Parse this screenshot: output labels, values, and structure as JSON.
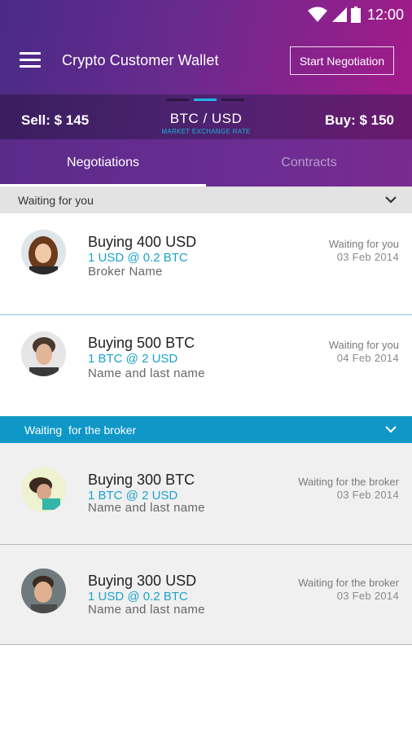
{
  "status_bar": {
    "time": "12:00"
  },
  "header": {
    "title": "Crypto Customer Wallet",
    "start_button": "Start Negotiation"
  },
  "rate_bar": {
    "sell": "Sell: $ 145",
    "pair": "BTC / USD",
    "subtitle": "MARKET EXCHANGE RATE",
    "buy": "Buy: $ 150",
    "accent": "#21b6e0"
  },
  "tabs": [
    {
      "label": "Negotiations",
      "active": true
    },
    {
      "label": "Contracts",
      "active": false
    }
  ],
  "sections": [
    {
      "title": "Waiting for you",
      "items": [
        {
          "title": "Buying 400 USD",
          "rate": "1 USD @ 0.2 BTC",
          "name": "Broker Name",
          "status": "Waiting for you",
          "date": "03 Feb 2014"
        },
        {
          "title": "Buying 500 BTC",
          "rate": "1 BTC @ 2 USD",
          "name": "Name and last name",
          "status": "Waiting for you",
          "date": "04 Feb 2014"
        }
      ]
    },
    {
      "title": "Waiting  for the broker",
      "items": [
        {
          "title": "Buying 300 BTC",
          "rate": "1 BTC @ 2 USD",
          "name": "Name and last name",
          "status": "Waiting for the broker",
          "date": "03 Feb 2014"
        },
        {
          "title": "Buying 300 USD",
          "rate": "1 USD @ 0.2 BTC",
          "name": "Name and last name",
          "status": "Waiting for the broker",
          "date": "03 Feb 2014"
        }
      ]
    }
  ],
  "colors": {
    "header_start": "#4a2a86",
    "header_end": "#a21b8a",
    "section_blue": "#0f97c7",
    "link_blue": "#1aa3cc"
  }
}
